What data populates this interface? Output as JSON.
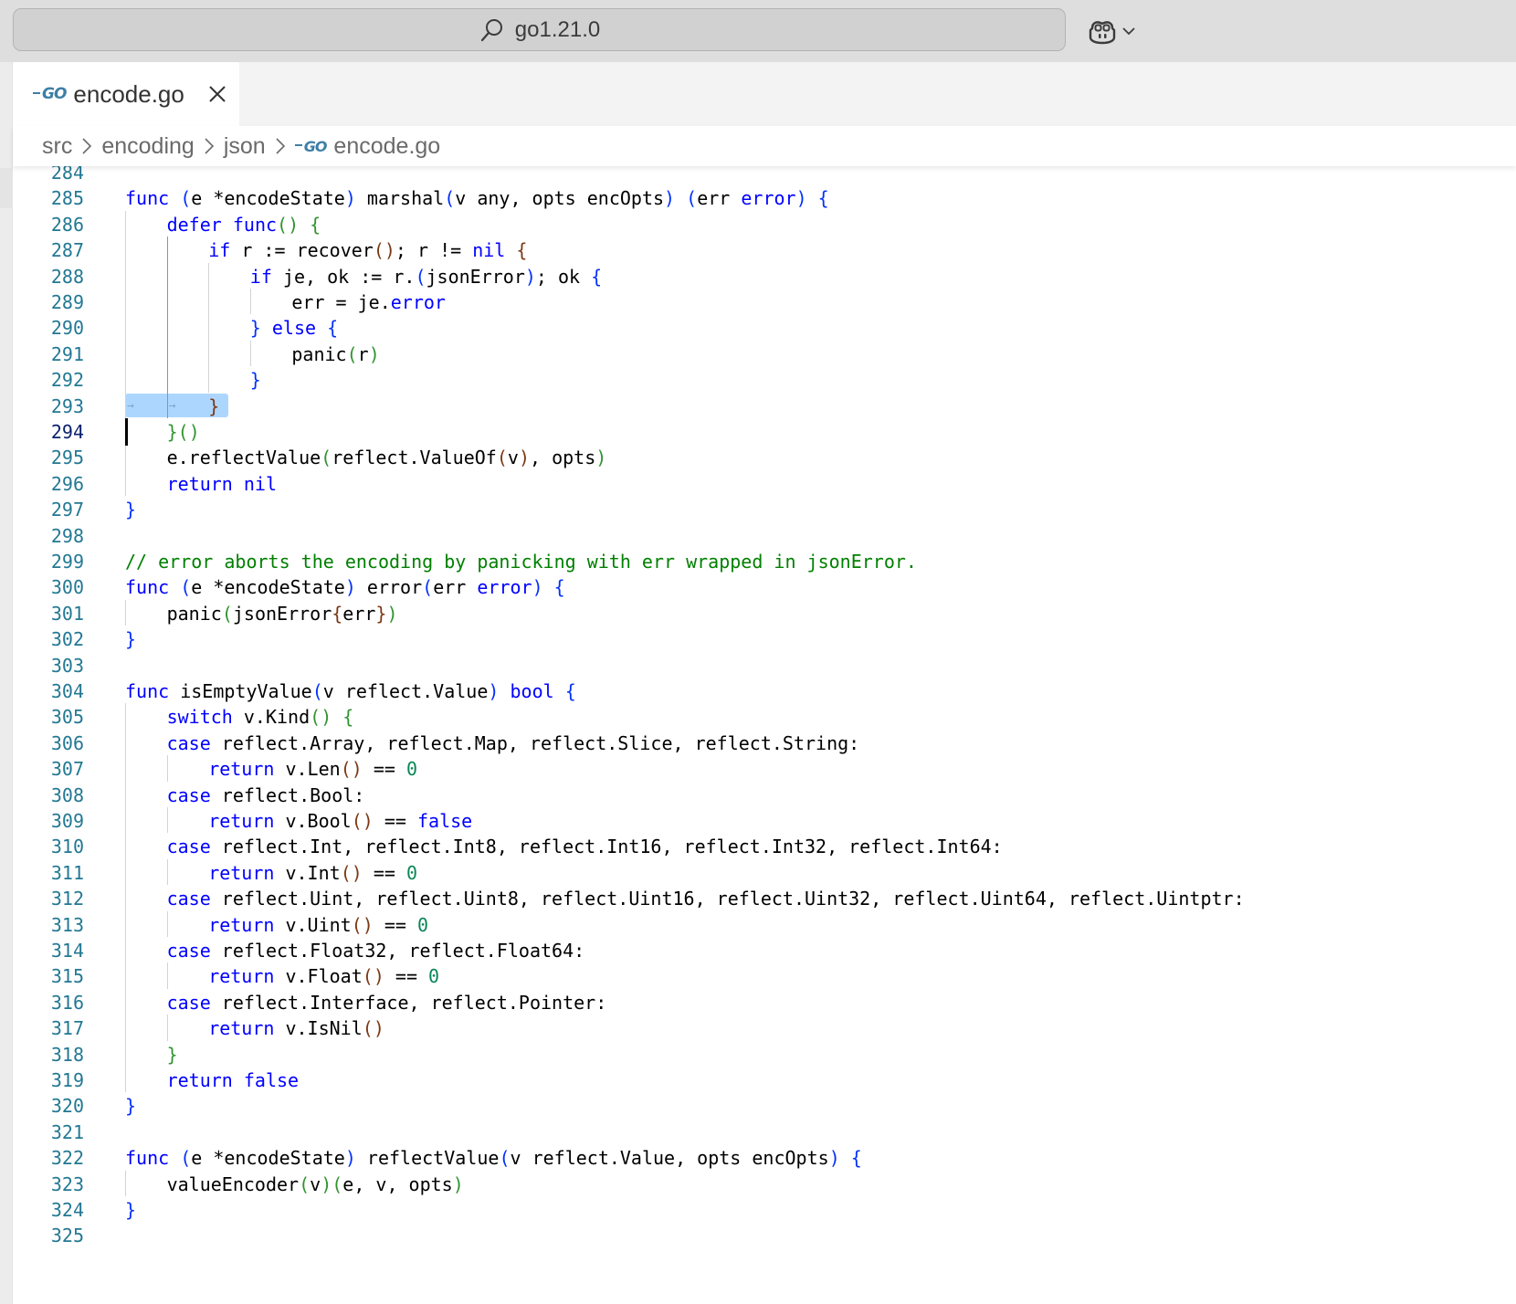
{
  "titlebar": {
    "search_label": "go1.21.0",
    "search_icon": "search-icon",
    "copilot_icon": "copilot-icon"
  },
  "tab": {
    "label": "encode.go",
    "badge": "GO",
    "close_icon": "close-icon"
  },
  "breadcrumb": {
    "items": [
      "src",
      "encoding",
      "json",
      "encode.go"
    ],
    "badge": "GO"
  },
  "editor": {
    "current_line": 294,
    "lines": [
      {
        "num": "284",
        "indent": 0,
        "tokens": []
      },
      {
        "num": "285",
        "indent": 0,
        "tokens": [
          [
            "func",
            "k"
          ],
          [
            " ",
            ""
          ],
          [
            "(",
            "b1"
          ],
          [
            "e *encodeState",
            ""
          ],
          [
            ")",
            "b1"
          ],
          [
            " marshal",
            ""
          ],
          [
            "(",
            "b1"
          ],
          [
            "v any, opts encOpts",
            ""
          ],
          [
            ")",
            "b1"
          ],
          [
            " ",
            ""
          ],
          [
            "(",
            "b1"
          ],
          [
            "err ",
            ""
          ],
          [
            "error",
            "k"
          ],
          [
            ")",
            "b1"
          ],
          [
            " ",
            ""
          ],
          [
            "{",
            "b1"
          ]
        ]
      },
      {
        "num": "286",
        "indent": 1,
        "tokens": [
          [
            "defer",
            "k"
          ],
          [
            " ",
            ""
          ],
          [
            "func",
            "k"
          ],
          [
            "(",
            "b2"
          ],
          [
            ")",
            "b2"
          ],
          [
            " ",
            ""
          ],
          [
            "{",
            "b2"
          ]
        ]
      },
      {
        "num": "287",
        "indent": 2,
        "tokens": [
          [
            "if",
            "k"
          ],
          [
            " r := recover",
            ""
          ],
          [
            "(",
            "b3"
          ],
          [
            ")",
            "b3"
          ],
          [
            "; r != ",
            ""
          ],
          [
            "nil",
            "k"
          ],
          [
            " ",
            ""
          ],
          [
            "{",
            "b3"
          ]
        ]
      },
      {
        "num": "288",
        "indent": 3,
        "tokens": [
          [
            "if",
            "k"
          ],
          [
            " je, ok := r.",
            ""
          ],
          [
            "(",
            "b1"
          ],
          [
            "jsonError",
            ""
          ],
          [
            ")",
            "b1"
          ],
          [
            "; ok ",
            ""
          ],
          [
            "{",
            "b1"
          ]
        ]
      },
      {
        "num": "289",
        "indent": 4,
        "tokens": [
          [
            "err = je.",
            ""
          ],
          [
            "error",
            "k"
          ]
        ]
      },
      {
        "num": "290",
        "indent": 3,
        "tokens": [
          [
            "}",
            "b1"
          ],
          [
            " ",
            ""
          ],
          [
            "else",
            "k"
          ],
          [
            " ",
            ""
          ],
          [
            "{",
            "b1"
          ]
        ]
      },
      {
        "num": "291",
        "indent": 4,
        "tokens": [
          [
            "panic",
            ""
          ],
          [
            "(",
            "b2"
          ],
          [
            "r",
            ""
          ],
          [
            ")",
            "b2"
          ]
        ]
      },
      {
        "num": "292",
        "indent": 3,
        "tokens": [
          [
            "}",
            "b1"
          ]
        ]
      },
      {
        "num": "293",
        "indent": 2,
        "tokens": [
          [
            "}",
            "b3"
          ]
        ]
      },
      {
        "num": "294",
        "indent": 1,
        "tokens": [
          [
            "}",
            "b2"
          ],
          [
            "(",
            "b2"
          ],
          [
            ")",
            "b2"
          ]
        ]
      },
      {
        "num": "295",
        "indent": 1,
        "tokens": [
          [
            "e.reflectValue",
            ""
          ],
          [
            "(",
            "b2"
          ],
          [
            "reflect.ValueOf",
            ""
          ],
          [
            "(",
            "b3"
          ],
          [
            "v",
            ""
          ],
          [
            ")",
            "b3"
          ],
          [
            ", opts",
            ""
          ],
          [
            ")",
            "b2"
          ]
        ]
      },
      {
        "num": "296",
        "indent": 1,
        "tokens": [
          [
            "return",
            "k"
          ],
          [
            " ",
            ""
          ],
          [
            "nil",
            "k"
          ]
        ]
      },
      {
        "num": "297",
        "indent": 0,
        "tokens": [
          [
            "}",
            "b1"
          ]
        ]
      },
      {
        "num": "298",
        "indent": 0,
        "tokens": []
      },
      {
        "num": "299",
        "indent": 0,
        "tokens": [
          [
            "// error aborts the encoding by panicking with err wrapped in jsonError.",
            "c"
          ]
        ]
      },
      {
        "num": "300",
        "indent": 0,
        "tokens": [
          [
            "func",
            "k"
          ],
          [
            " ",
            ""
          ],
          [
            "(",
            "b1"
          ],
          [
            "e *encodeState",
            ""
          ],
          [
            ")",
            "b1"
          ],
          [
            " error",
            ""
          ],
          [
            "(",
            "b1"
          ],
          [
            "err ",
            ""
          ],
          [
            "error",
            "k"
          ],
          [
            ")",
            "b1"
          ],
          [
            " ",
            ""
          ],
          [
            "{",
            "b1"
          ]
        ]
      },
      {
        "num": "301",
        "indent": 1,
        "tokens": [
          [
            "panic",
            ""
          ],
          [
            "(",
            "b2"
          ],
          [
            "jsonError",
            ""
          ],
          [
            "{",
            "b3"
          ],
          [
            "err",
            ""
          ],
          [
            "}",
            "b3"
          ],
          [
            ")",
            "b2"
          ]
        ]
      },
      {
        "num": "302",
        "indent": 0,
        "tokens": [
          [
            "}",
            "b1"
          ]
        ]
      },
      {
        "num": "303",
        "indent": 0,
        "tokens": []
      },
      {
        "num": "304",
        "indent": 0,
        "tokens": [
          [
            "func",
            "k"
          ],
          [
            " isEmptyValue",
            ""
          ],
          [
            "(",
            "b1"
          ],
          [
            "v reflect.Value",
            ""
          ],
          [
            ")",
            "b1"
          ],
          [
            " ",
            ""
          ],
          [
            "bool",
            "k"
          ],
          [
            " ",
            ""
          ],
          [
            "{",
            "b1"
          ]
        ]
      },
      {
        "num": "305",
        "indent": 1,
        "tokens": [
          [
            "switch",
            "k"
          ],
          [
            " v.Kind",
            ""
          ],
          [
            "(",
            "b2"
          ],
          [
            ")",
            "b2"
          ],
          [
            " ",
            ""
          ],
          [
            "{",
            "b2"
          ]
        ]
      },
      {
        "num": "306",
        "indent": 1,
        "tokens": [
          [
            "case",
            "k"
          ],
          [
            " reflect.Array, reflect.Map, reflect.Slice, reflect.String:",
            ""
          ]
        ]
      },
      {
        "num": "307",
        "indent": 2,
        "tokens": [
          [
            "return",
            "k"
          ],
          [
            " v.Len",
            ""
          ],
          [
            "(",
            "b3"
          ],
          [
            ")",
            "b3"
          ],
          [
            " == ",
            ""
          ],
          [
            "0",
            "n"
          ]
        ]
      },
      {
        "num": "308",
        "indent": 1,
        "tokens": [
          [
            "case",
            "k"
          ],
          [
            " reflect.Bool:",
            ""
          ]
        ]
      },
      {
        "num": "309",
        "indent": 2,
        "tokens": [
          [
            "return",
            "k"
          ],
          [
            " v.Bool",
            ""
          ],
          [
            "(",
            "b3"
          ],
          [
            ")",
            "b3"
          ],
          [
            " == ",
            ""
          ],
          [
            "false",
            "k"
          ]
        ]
      },
      {
        "num": "310",
        "indent": 1,
        "tokens": [
          [
            "case",
            "k"
          ],
          [
            " reflect.Int, reflect.Int8, reflect.Int16, reflect.Int32, reflect.Int64:",
            ""
          ]
        ]
      },
      {
        "num": "311",
        "indent": 2,
        "tokens": [
          [
            "return",
            "k"
          ],
          [
            " v.Int",
            ""
          ],
          [
            "(",
            "b3"
          ],
          [
            ")",
            "b3"
          ],
          [
            " == ",
            ""
          ],
          [
            "0",
            "n"
          ]
        ]
      },
      {
        "num": "312",
        "indent": 1,
        "tokens": [
          [
            "case",
            "k"
          ],
          [
            " reflect.Uint, reflect.Uint8, reflect.Uint16, reflect.Uint32, reflect.Uint64, reflect.Uintptr:",
            ""
          ]
        ]
      },
      {
        "num": "313",
        "indent": 2,
        "tokens": [
          [
            "return",
            "k"
          ],
          [
            " v.Uint",
            ""
          ],
          [
            "(",
            "b3"
          ],
          [
            ")",
            "b3"
          ],
          [
            " == ",
            ""
          ],
          [
            "0",
            "n"
          ]
        ]
      },
      {
        "num": "314",
        "indent": 1,
        "tokens": [
          [
            "case",
            "k"
          ],
          [
            " reflect.Float32, reflect.Float64:",
            ""
          ]
        ]
      },
      {
        "num": "315",
        "indent": 2,
        "tokens": [
          [
            "return",
            "k"
          ],
          [
            " v.Float",
            ""
          ],
          [
            "(",
            "b3"
          ],
          [
            ")",
            "b3"
          ],
          [
            " == ",
            ""
          ],
          [
            "0",
            "n"
          ]
        ]
      },
      {
        "num": "316",
        "indent": 1,
        "tokens": [
          [
            "case",
            "k"
          ],
          [
            " reflect.Interface, reflect.Pointer:",
            ""
          ]
        ]
      },
      {
        "num": "317",
        "indent": 2,
        "tokens": [
          [
            "return",
            "k"
          ],
          [
            " v.IsNil",
            ""
          ],
          [
            "(",
            "b3"
          ],
          [
            ")",
            "b3"
          ]
        ]
      },
      {
        "num": "318",
        "indent": 1,
        "tokens": [
          [
            "}",
            "b2"
          ]
        ]
      },
      {
        "num": "319",
        "indent": 1,
        "tokens": [
          [
            "return",
            "k"
          ],
          [
            " ",
            ""
          ],
          [
            "false",
            "k"
          ]
        ]
      },
      {
        "num": "320",
        "indent": 0,
        "tokens": [
          [
            "}",
            "b1"
          ]
        ]
      },
      {
        "num": "321",
        "indent": 0,
        "tokens": []
      },
      {
        "num": "322",
        "indent": 0,
        "tokens": [
          [
            "func",
            "k"
          ],
          [
            " ",
            ""
          ],
          [
            "(",
            "b1"
          ],
          [
            "e *encodeState",
            ""
          ],
          [
            ")",
            "b1"
          ],
          [
            " reflectValue",
            ""
          ],
          [
            "(",
            "b1"
          ],
          [
            "v reflect.Value, opts encOpts",
            ""
          ],
          [
            ")",
            "b1"
          ],
          [
            " ",
            ""
          ],
          [
            "{",
            "b1"
          ]
        ]
      },
      {
        "num": "323",
        "indent": 1,
        "tokens": [
          [
            "valueEncoder",
            ""
          ],
          [
            "(",
            "b2"
          ],
          [
            "v",
            ""
          ],
          [
            ")",
            "b2"
          ],
          [
            "(",
            "b2"
          ],
          [
            "e, v, opts",
            ""
          ],
          [
            ")",
            "b2"
          ]
        ]
      },
      {
        "num": "324",
        "indent": 0,
        "tokens": [
          [
            "}",
            "b1"
          ]
        ]
      },
      {
        "num": "325",
        "indent": 0,
        "tokens": []
      }
    ]
  }
}
